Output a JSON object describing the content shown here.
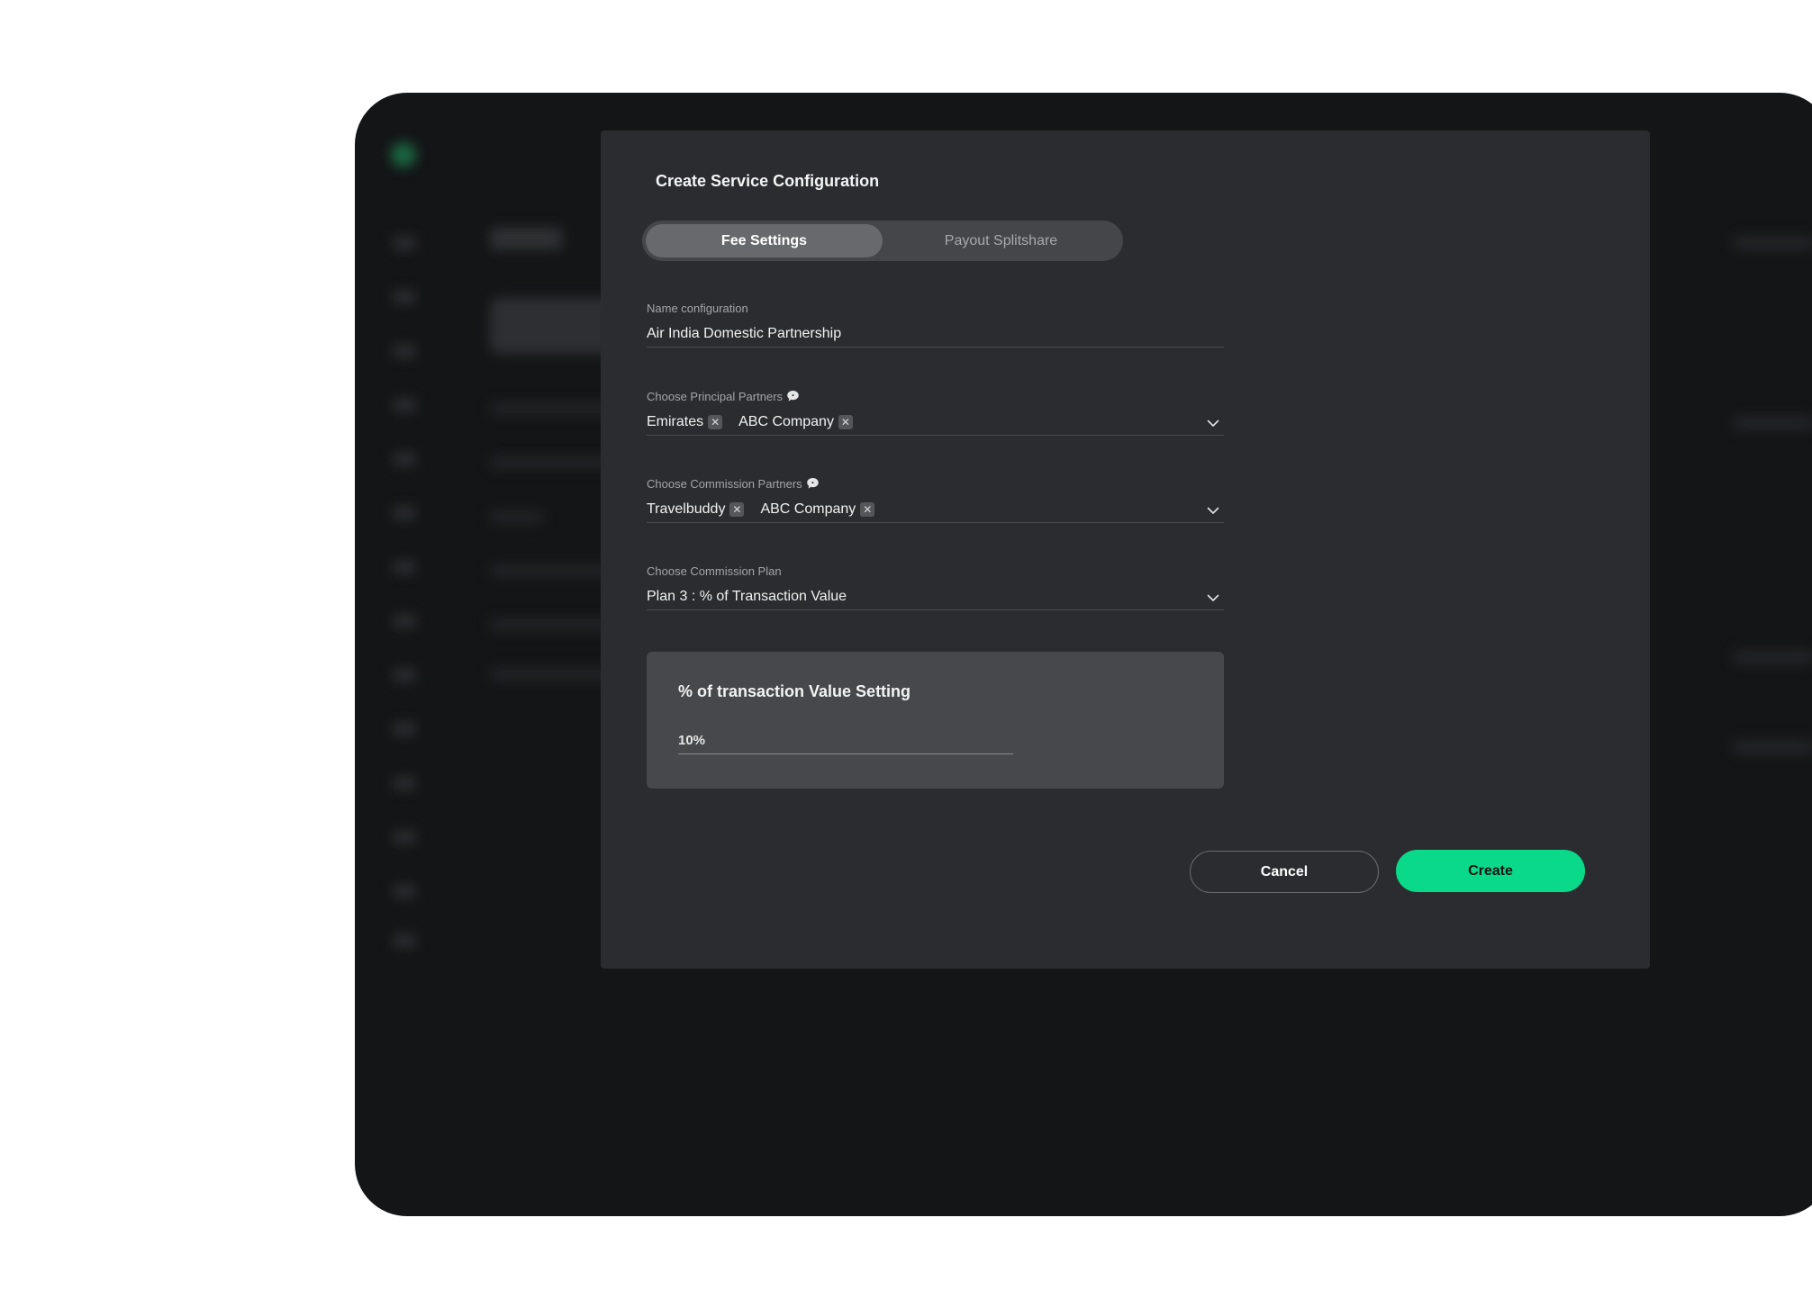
{
  "modal": {
    "title": "Create Service Configuration",
    "tabs": [
      {
        "label": "Fee Settings",
        "active": true
      },
      {
        "label": "Payout Splitshare",
        "active": false
      }
    ],
    "name_field": {
      "label": "Name configuration",
      "value": "Air India Domestic Partnership"
    },
    "principal_partners": {
      "label": "Choose Principal Partners",
      "chips": [
        "Emirates",
        "ABC Company"
      ],
      "icon": "chat-bubble-icon"
    },
    "commission_partners": {
      "label": "Choose Commission Partners",
      "chips": [
        "Travelbuddy",
        "ABC Company"
      ],
      "icon": "chat-bubble-icon"
    },
    "commission_plan": {
      "label": "Choose Commission Plan",
      "value": "Plan 3 : % of Transaction Value"
    },
    "transaction_setting": {
      "title": "% of transaction Value Setting",
      "value": "10%"
    },
    "buttons": {
      "cancel": "Cancel",
      "create": "Create"
    }
  },
  "colors": {
    "accent": "#0bd98a",
    "modal_bg": "#2b2c2f",
    "device_bg": "#141517",
    "setting_box_bg": "#47484c"
  }
}
